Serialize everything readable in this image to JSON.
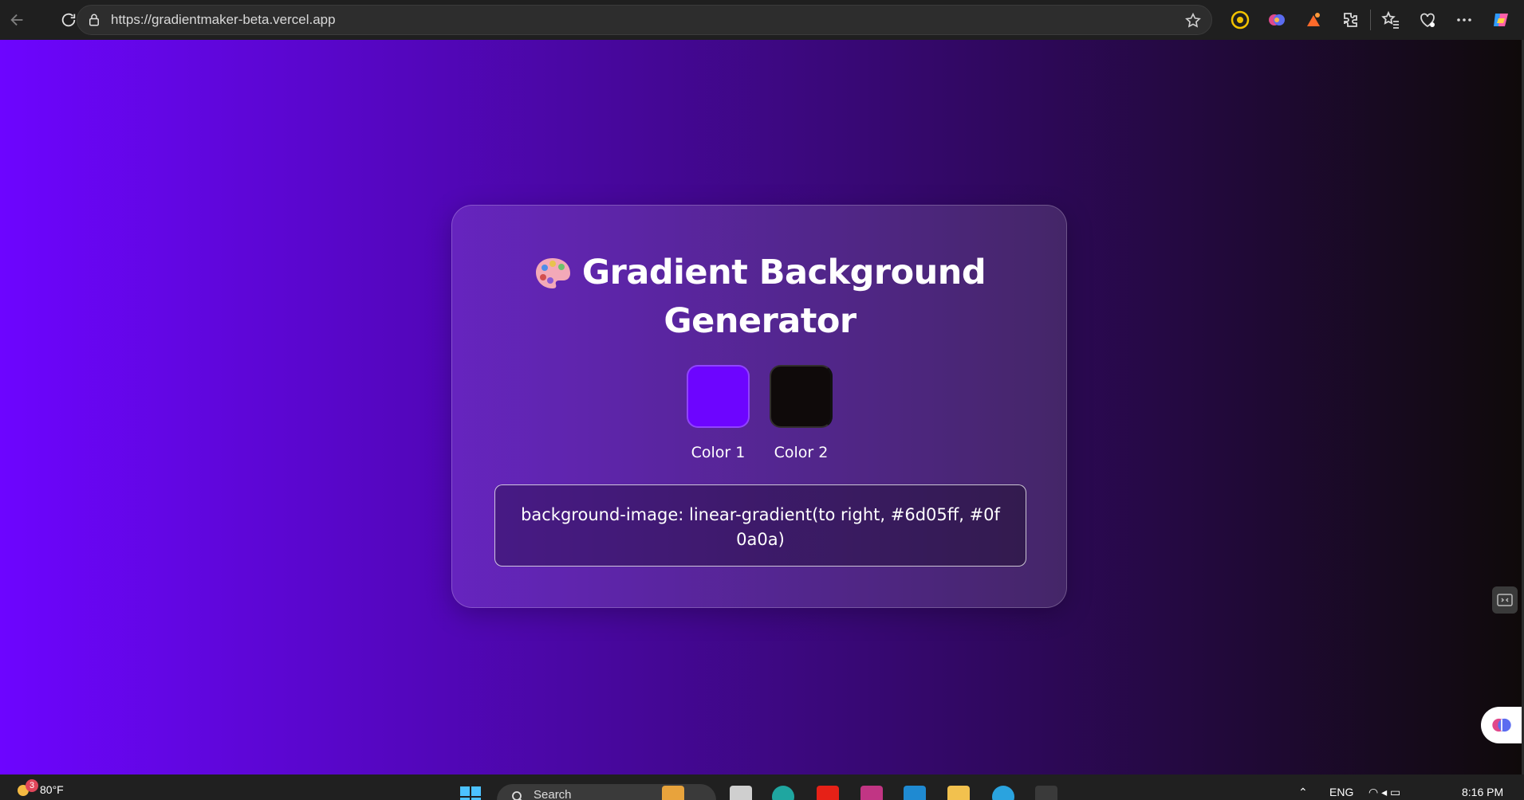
{
  "browser": {
    "url": "https://gradientmaker-beta.vercel.app"
  },
  "app": {
    "title_line1": "Gradient Background",
    "title_line2": "Generator",
    "color1": {
      "label": "Color 1",
      "value": "#6d05ff"
    },
    "color2": {
      "label": "Color 2",
      "value": "#0f0a0a"
    },
    "css_output": "background-image: linear-gradient(to right, #6d05ff, #0f0a0a)"
  },
  "taskbar": {
    "weather_temp": "80°F",
    "weather_badge": "3",
    "search_placeholder": "Search",
    "language": "ENG",
    "time": "8:16 PM"
  }
}
